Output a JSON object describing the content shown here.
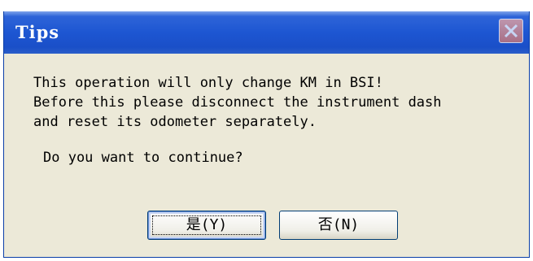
{
  "dialog": {
    "title": "Tips",
    "message_lines": [
      "This operation will only change KM in BSI!",
      "Before this please disconnect the instrument dash",
      "and reset its odometer separately."
    ],
    "question": "Do you want to continue?",
    "yes_label": "是(Y)",
    "no_label": "否(N)"
  },
  "icons": {
    "close": "close-icon"
  },
  "colors": {
    "titlebar": "#1d56d2",
    "body": "#ece9d8",
    "close_button": "#d87a70"
  }
}
